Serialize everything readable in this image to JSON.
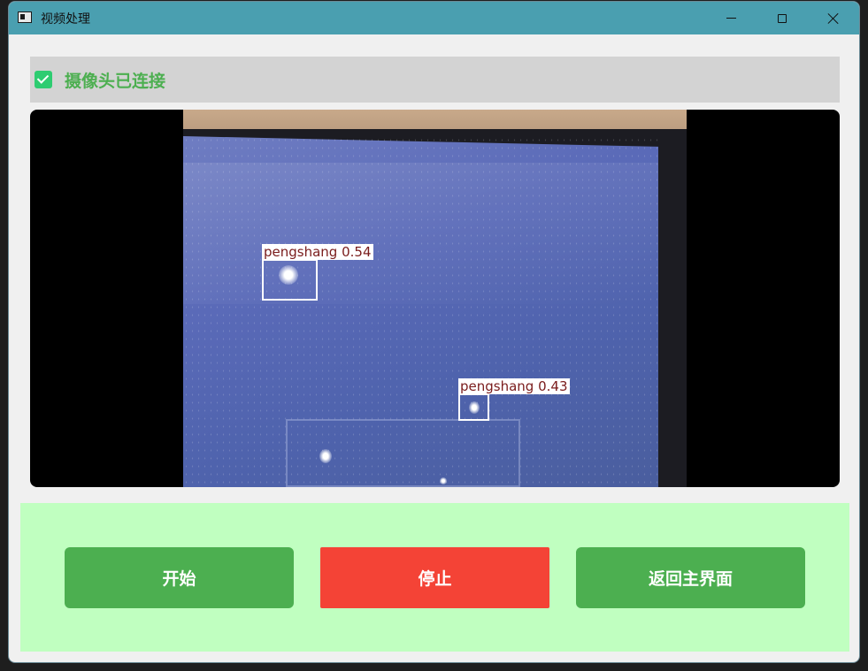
{
  "window": {
    "title": "视频处理",
    "controls": [
      "minimize",
      "maximize",
      "close"
    ]
  },
  "status": {
    "checked": true,
    "text": "摄像头已连接",
    "text_color": "#4caf50",
    "icon": "check-icon"
  },
  "video": {
    "detections": [
      {
        "label": "pengshang 0.54"
      },
      {
        "label": "pengshang 0.43"
      }
    ]
  },
  "controls": {
    "start_label": "开始",
    "stop_label": "停止",
    "back_label": "返回主界面"
  },
  "colors": {
    "titlebar": "#4a9fb0",
    "panel": "#c0ffc0",
    "primary_button": "#4caf50",
    "stop_button": "#f44336",
    "status_bar": "#d3d3d3"
  }
}
